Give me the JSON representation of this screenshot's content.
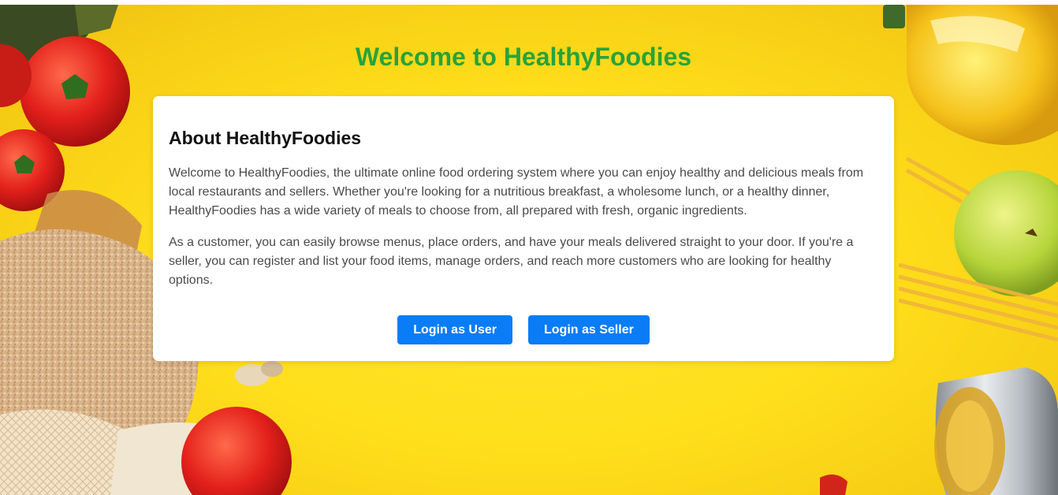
{
  "page": {
    "title": "Welcome to HealthyFoodies"
  },
  "about": {
    "heading": "About HealthyFoodies",
    "paragraphs": [
      "Welcome to HealthyFoodies, the ultimate online food ordering system where you can enjoy healthy and delicious meals from local restaurants and sellers. Whether you're looking for a nutritious breakfast, a wholesome lunch, or a healthy dinner, HealthyFoodies has a wide variety of meals to choose from, all prepared with fresh, organic ingredients.",
      "As a customer, you can easily browse menus, place orders, and have your meals delivered straight to your door. If you're a seller, you can register and list your food items, manage orders, and reach more customers who are looking for healthy options."
    ]
  },
  "actions": {
    "login_user": "Login as User",
    "login_seller": "Login as Seller"
  },
  "colors": {
    "title_green": "#27a33a",
    "button_blue": "#0a7cf6",
    "background_yellow": "#ffdf1c"
  }
}
